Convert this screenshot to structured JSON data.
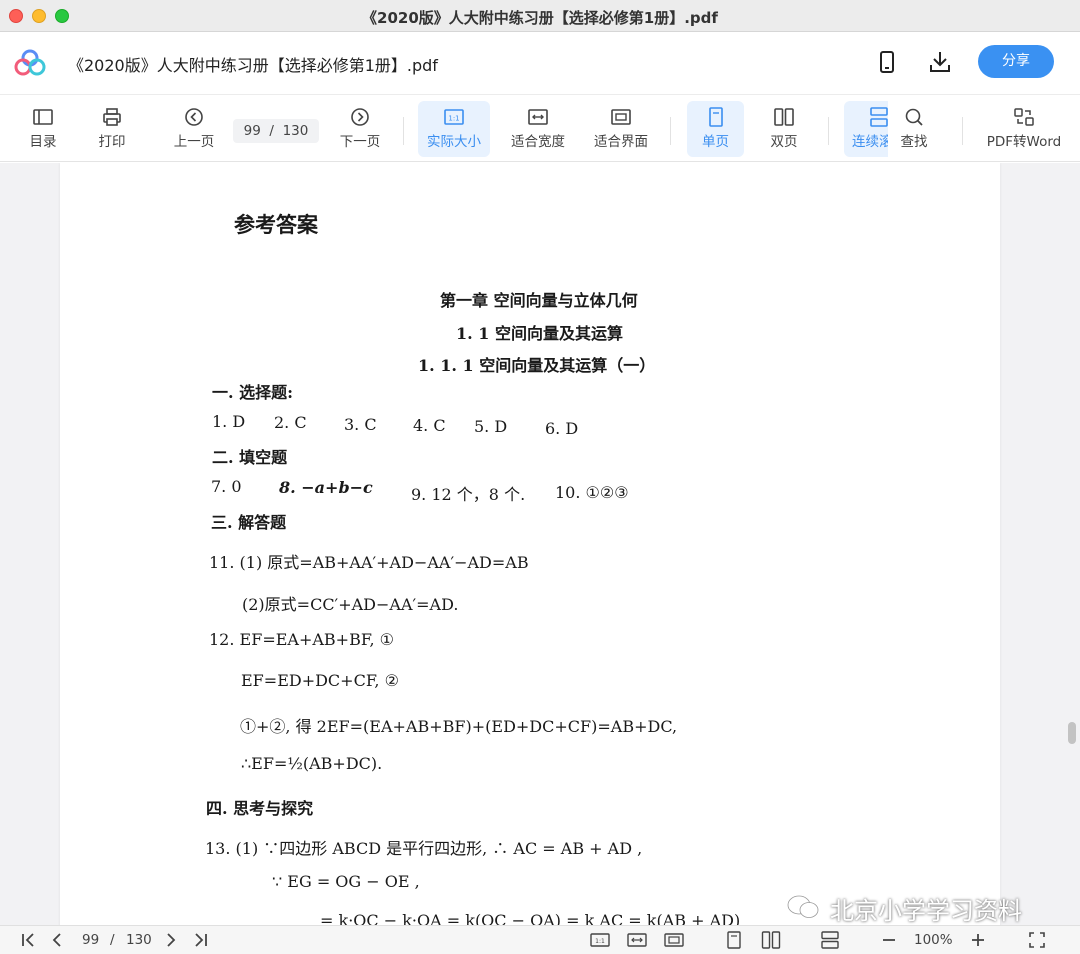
{
  "window": {
    "title": "《2020版》人大附中练习册【选择必修第1册】.pdf"
  },
  "header": {
    "doc_title": "《2020版》人大附中练习册【选择必修第1册】.pdf",
    "share_label": "分享",
    "accent": "#3a91f2"
  },
  "toolbar": {
    "toc": "目录",
    "print": "打印",
    "prev": "上一页",
    "current_page": "99",
    "page_sep": "/",
    "total_pages": "130",
    "next": "下一页",
    "actual_size": "实际大小",
    "fit_width": "适合宽度",
    "fit_page": "适合界面",
    "single": "单页",
    "double": "双页",
    "continuous": "连续滚",
    "find": "查找",
    "pdf_to_word": "PDF转Word"
  },
  "document": {
    "heading": "参考答案",
    "chapter": "第一章  空间向量与立体几何",
    "section": "1. 1  空间向量及其运算",
    "subsection": "1. 1. 1  空间向量及其运算（一）",
    "s1": "一. 选择题:",
    "mc": [
      "1. D",
      "2. C",
      "3. C",
      "4. C",
      "5. D",
      "6. D"
    ],
    "s2": "二. 填空题",
    "fill": [
      "7. 0",
      "8. −a+b−c",
      "9. 12 个，8 个.",
      "10. ①②③"
    ],
    "s3": "三. 解答题",
    "q11a": "11. (1) 原式=AB+AA′+AD−AA′−AD=AB",
    "q11b": "(2)原式=CC′+AD−AA′=AD.",
    "q12a": "12. EF=EA+AB+BF, ①",
    "q12b": "EF=ED+DC+CF, ②",
    "q12c": "①+②, 得 2EF=(EA+AB+BF)+(ED+DC+CF)=AB+DC,",
    "q12d": "∴EF=½(AB+DC).",
    "s4": "四. 思考与探究",
    "q13a": "13. (1) ∵四边形 ABCD 是平行四边形, ∴ AC = AB + AD ,",
    "q13b": "∵ EG = OG − OE ,",
    "q13c": "= k·OC − k·OA = k(OC − OA) = k AC = k(AB + AD)"
  },
  "watermark": "北京小学学习资料",
  "statusbar": {
    "current_page": "99",
    "page_sep": "/",
    "total_pages": "130",
    "zoom": "100%"
  }
}
